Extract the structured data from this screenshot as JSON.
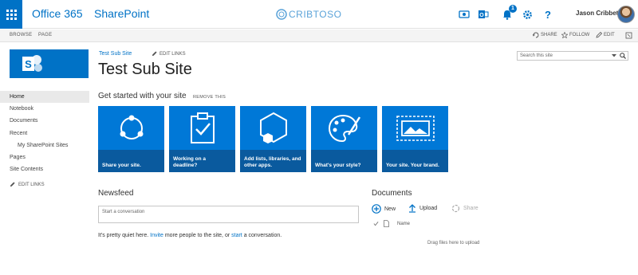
{
  "suitebar": {
    "brand": "Office 365",
    "app_title": "SharePoint",
    "center_logo": "CRIBTOSO",
    "notifications_count": "1",
    "user_name": "Jason Cribbet",
    "icons": [
      "waffle-icon",
      "video-icon",
      "outlook-icon",
      "bell-icon",
      "gear-icon",
      "help-icon"
    ]
  },
  "ribbon": {
    "tabs": [
      "BROWSE",
      "PAGE"
    ],
    "share": "SHARE",
    "follow": "FOLLOW",
    "edit": "EDIT"
  },
  "site": {
    "breadcrumb": "Test Sub Site",
    "edit_links": "EDIT LINKS",
    "title": "Test Sub Site",
    "search_placeholder": "Search this site"
  },
  "leftnav": {
    "items": [
      {
        "label": "Home",
        "selected": true
      },
      {
        "label": "Notebook"
      },
      {
        "label": "Documents"
      },
      {
        "label": "Recent"
      },
      {
        "label": "My SharePoint Sites",
        "sub": true
      },
      {
        "label": "Pages"
      },
      {
        "label": "Site Contents"
      }
    ],
    "edit_links": "EDIT LINKS"
  },
  "get_started": {
    "title": "Get started with your site",
    "remove": "REMOVE THIS",
    "tiles": [
      {
        "caption": "Share your site.",
        "icon": "share-icon"
      },
      {
        "caption": "Working on a deadline?",
        "icon": "clipboard-check-icon"
      },
      {
        "caption": "Add lists, libraries, and other apps.",
        "icon": "hexagon-apps-icon"
      },
      {
        "caption": "What's your style?",
        "icon": "palette-icon"
      },
      {
        "caption": "Your site. Your brand.",
        "icon": "picture-icon"
      }
    ]
  },
  "newsfeed": {
    "title": "Newsfeed",
    "placeholder": "Start a conversation",
    "quiet_pre": "It's pretty quiet here.",
    "invite": "Invite",
    "quiet_mid": "more people to the site, or",
    "start": "start",
    "quiet_post": "a conversation."
  },
  "documents": {
    "title": "Documents",
    "new": "New",
    "upload": "Upload",
    "share": "Share",
    "col_name": "Name",
    "drop_hint": "Drag files here to upload"
  },
  "colors": {
    "accent": "#0072c6",
    "tile": "#0078d7",
    "tile_caption": "#0a5a9e"
  }
}
